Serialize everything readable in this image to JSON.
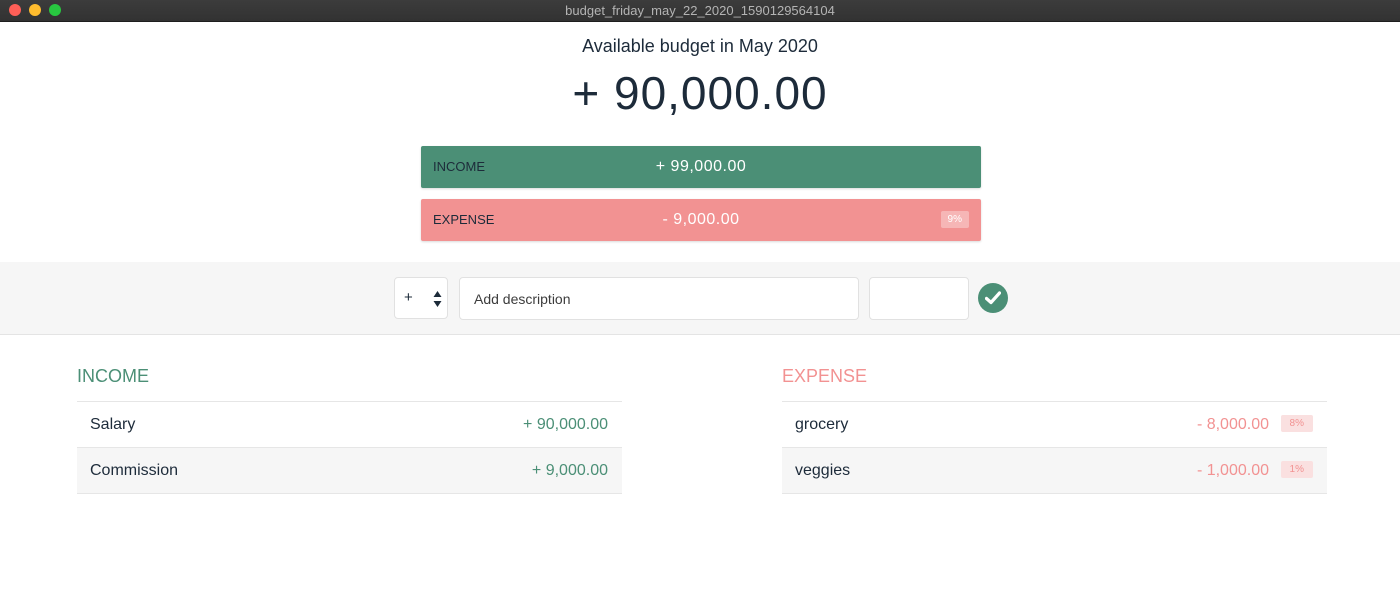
{
  "window": {
    "title": "budget_friday_may_22_2020_1590129564104"
  },
  "budget": {
    "title": "Available budget in May 2020",
    "value": "+ 90,000.00"
  },
  "summary": {
    "income": {
      "label": "INCOME",
      "value": "+ 99,000.00"
    },
    "expense": {
      "label": "EXPENSE",
      "value": "- 9,000.00",
      "percentage": "9%"
    }
  },
  "add_form": {
    "type_value": "+",
    "description_placeholder": "Add description",
    "value_placeholder": "",
    "submit_icon": "check-circle-icon"
  },
  "income_list": {
    "title": "INCOME",
    "items": [
      {
        "description": "Salary",
        "value": "+ 90,000.00"
      },
      {
        "description": "Commission",
        "value": "+ 9,000.00"
      }
    ]
  },
  "expense_list": {
    "title": "EXPENSE",
    "items": [
      {
        "description": "grocery",
        "value": "- 8,000.00",
        "percentage": "8%"
      },
      {
        "description": "veggies",
        "value": "- 1,000.00",
        "percentage": "1%"
      }
    ]
  },
  "colors": {
    "income": "#4b8f76",
    "expense": "#f29292",
    "text": "#1d2b3a"
  }
}
